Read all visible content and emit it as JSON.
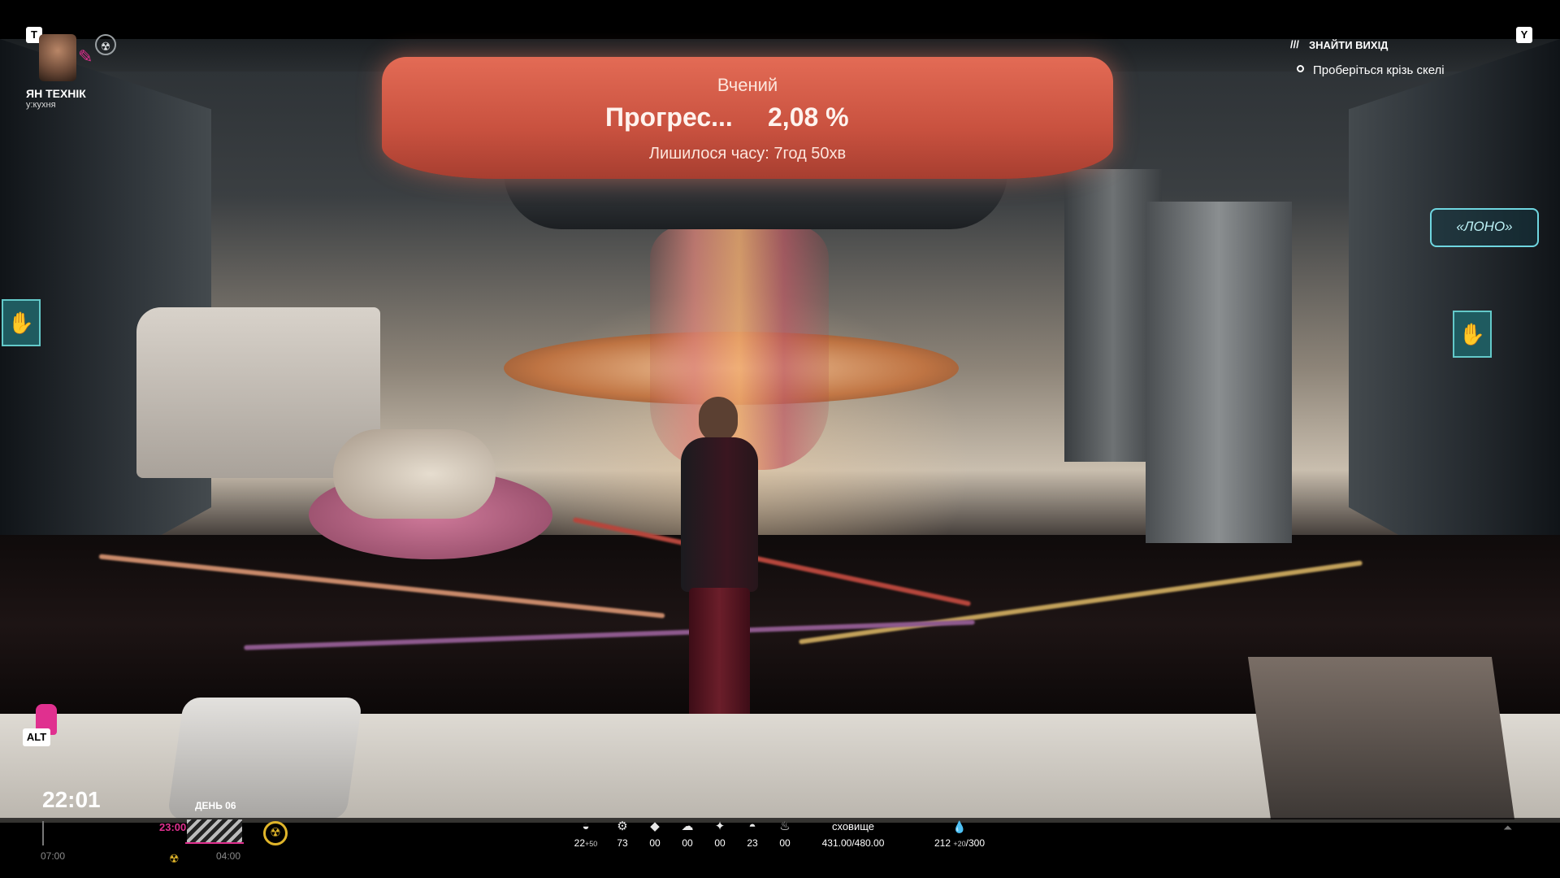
{
  "character": {
    "name": "ЯН ТЕХНІК",
    "location": "у:кухня",
    "key_hint": "T"
  },
  "objective": {
    "key_hint": "Y",
    "slashes": "///",
    "title": "ЗНАЙТИ ВИХІД",
    "task": "Проберіться крізь скелі"
  },
  "progress_panel": {
    "title": "Вчений",
    "label": "Прогрес...",
    "value": "2,08 %",
    "time_left": "Лишилося часу: 7год 50хв"
  },
  "room_sign": "«ЛОНО»",
  "alt_hint": "ALT",
  "clock": {
    "time": "22:01",
    "day": "ДЕНЬ  06",
    "tl_start": "07:00",
    "tl_mark": "23:00",
    "tl_end": "04:00"
  },
  "resources": [
    {
      "icon": "food-icon",
      "glyph": "◒",
      "value": "22",
      "delta": "+50"
    },
    {
      "icon": "parts-icon",
      "glyph": "⚙",
      "value": "73",
      "delta": ""
    },
    {
      "icon": "crystal-icon",
      "glyph": "◆",
      "value": "00",
      "delta": ""
    },
    {
      "icon": "weather-icon",
      "glyph": "☁",
      "value": "00",
      "delta": ""
    },
    {
      "icon": "seed-icon",
      "glyph": "✦",
      "value": "00",
      "delta": ""
    },
    {
      "icon": "dish-icon",
      "glyph": "◓",
      "value": "23",
      "delta": ""
    },
    {
      "icon": "pot-icon",
      "glyph": "♨",
      "value": "00",
      "delta": ""
    }
  ],
  "storage": {
    "label": "сховище",
    "value": "431.00/480.00"
  },
  "water": {
    "icon": "water-drop-icon",
    "value": "212",
    "delta": "+20",
    "max": "/300"
  },
  "colors": {
    "accent": "#e0308f",
    "panel": "#d45a45",
    "hazard": "#e0b52a",
    "sign": "#6fd6e0"
  }
}
